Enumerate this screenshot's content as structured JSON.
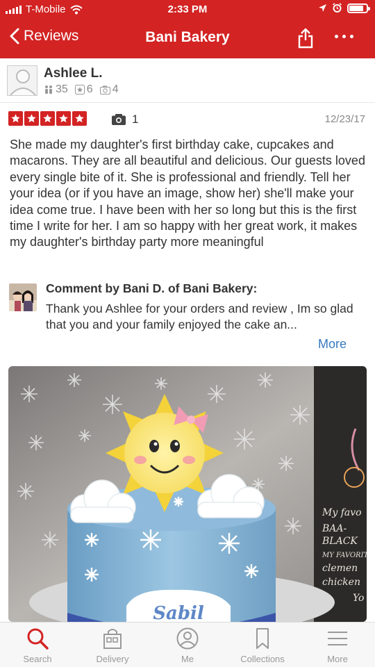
{
  "status_bar": {
    "carrier": "T-Mobile",
    "time": "2:33 PM",
    "battery_level": 0.85
  },
  "nav": {
    "back_label": "Reviews",
    "title": "Bani Bakery",
    "icons": [
      "share-icon",
      "more-dots-icon"
    ]
  },
  "reviewer": {
    "name": "Ashlee L.",
    "friends": "35",
    "reviews": "6",
    "photos": "4"
  },
  "review": {
    "rating": 5,
    "photo_count": "1",
    "date": "12/23/17",
    "text": "She made my daughter's first birthday cake, cupcakes and macarons. They are all beautiful and delicious. Our guests loved every single bite of it. She is professional and friendly. Tell her your idea (or if you have an image, show her) she'll make your idea come true. I have been with her so long but this is the first time I write for her. I am so happy with her great work, it makes my daughter's birthday party more meaningful"
  },
  "owner_comment": {
    "title": "Comment by Bani D. of Bani Bakery:",
    "text": "Thank you Ashlee for your orders and review , Im so glad that you and your family enjoyed the cake an...",
    "more_label": "More"
  },
  "photo": {
    "cake_text": "Sabil",
    "board_lines": [
      "My favo",
      "BAA-",
      "BLACK",
      "MY FAVORITE",
      "clemen",
      "chicken",
      "Yo"
    ]
  },
  "tabbar": {
    "active": "Search",
    "tabs": [
      {
        "label": "Search",
        "icon": "search-icon"
      },
      {
        "label": "Delivery",
        "icon": "delivery-bag-icon"
      },
      {
        "label": "Me",
        "icon": "profile-icon"
      },
      {
        "label": "Collections",
        "icon": "bookmark-icon"
      },
      {
        "label": "More",
        "icon": "menu-icon"
      }
    ]
  },
  "colors": {
    "brand_red": "#d32323",
    "link_blue": "#3578c0",
    "muted_gray": "#888888"
  }
}
